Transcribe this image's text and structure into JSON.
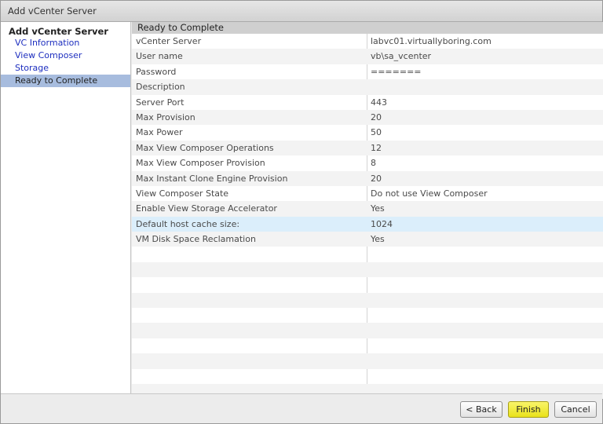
{
  "window": {
    "title": "Add vCenter Server"
  },
  "sidebar": {
    "heading": "Add vCenter Server",
    "items": [
      {
        "label": "VC Information"
      },
      {
        "label": "View Composer"
      },
      {
        "label": "Storage"
      },
      {
        "label": "Ready to Complete",
        "active": true
      }
    ]
  },
  "main": {
    "header": "Ready to Complete",
    "rows": [
      {
        "label": "vCenter Server",
        "value": "labvc01.virtuallyboring.com"
      },
      {
        "label": "User name",
        "value": "vb\\sa_vcenter"
      },
      {
        "label": "Password",
        "value": "======="
      },
      {
        "label": "Description",
        "value": ""
      },
      {
        "label": "Server Port",
        "value": "443"
      },
      {
        "label": "Max Provision",
        "value": "20"
      },
      {
        "label": "Max Power",
        "value": "50"
      },
      {
        "label": "Max View Composer Operations",
        "value": "12"
      },
      {
        "label": "Max View Composer Provision",
        "value": "8"
      },
      {
        "label": "Max Instant Clone Engine Provision",
        "value": "20"
      },
      {
        "label": "View Composer State",
        "value": "Do not use View Composer"
      },
      {
        "label": "Enable View Storage Accelerator",
        "value": "Yes"
      },
      {
        "label": "Default host cache size:",
        "value": "1024",
        "highlighted": true
      },
      {
        "label": "VM Disk Space Reclamation",
        "value": "Yes"
      }
    ]
  },
  "footer": {
    "back_label": "< Back",
    "finish_label": "Finish",
    "cancel_label": "Cancel"
  },
  "colors": {
    "active_item_bg": "#a7bcde",
    "highlight_row_bg": "#dbeefb",
    "finish_button": "#e9e21a",
    "link": "#1d2ebf"
  }
}
